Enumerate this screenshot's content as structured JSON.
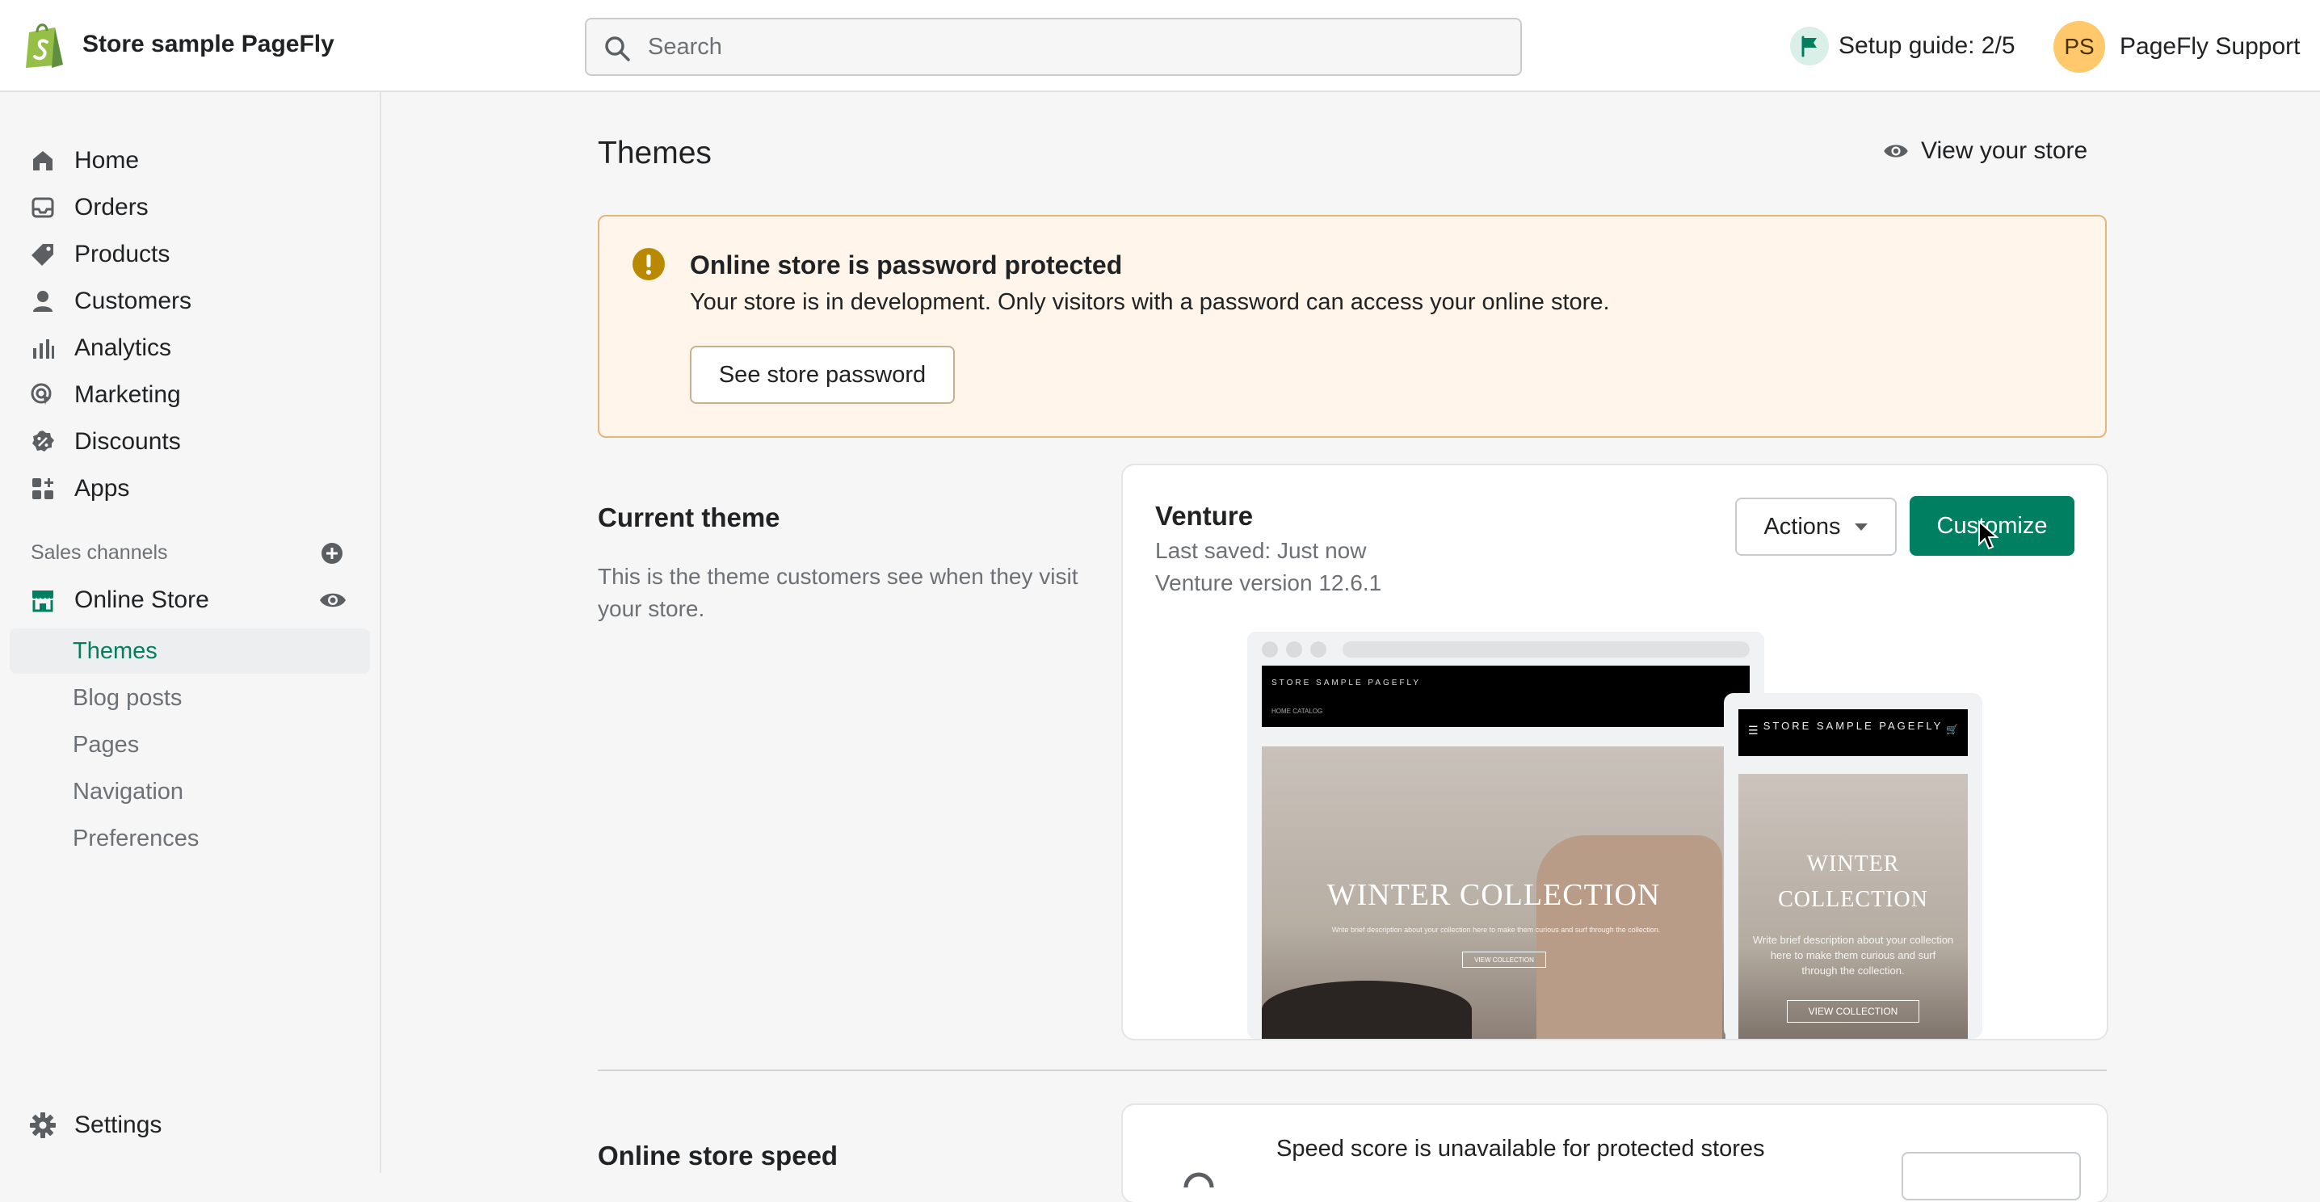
{
  "topbar": {
    "store_name": "Store sample PageFly",
    "search_placeholder": "Search",
    "setup_guide": "Setup guide: 2/5",
    "user_initials": "PS",
    "user_name": "PageFly Support"
  },
  "sidebar": {
    "items": [
      {
        "label": "Home",
        "icon": "home-icon"
      },
      {
        "label": "Orders",
        "icon": "inbox-icon"
      },
      {
        "label": "Products",
        "icon": "tag-icon"
      },
      {
        "label": "Customers",
        "icon": "person-icon"
      },
      {
        "label": "Analytics",
        "icon": "bar-chart-icon"
      },
      {
        "label": "Marketing",
        "icon": "target-icon"
      },
      {
        "label": "Discounts",
        "icon": "discount-icon"
      },
      {
        "label": "Apps",
        "icon": "apps-icon"
      }
    ],
    "sales_channels_label": "Sales channels",
    "online_store_label": "Online Store",
    "sub_items": [
      "Themes",
      "Blog posts",
      "Pages",
      "Navigation",
      "Preferences"
    ],
    "active_sub_item": "Themes",
    "settings_label": "Settings"
  },
  "main": {
    "page_title": "Themes",
    "view_store_label": "View your store",
    "banner": {
      "title": "Online store is password protected",
      "description": "Your store is in development. Only visitors with a password can access your online store.",
      "button_label": "See store password"
    },
    "current_theme": {
      "section_title": "Current theme",
      "section_description": "This is the theme customers see when they visit your store.",
      "theme_name": "Venture",
      "last_saved": "Last saved: Just now",
      "version": "Venture version 12.6.1",
      "actions_label": "Actions",
      "customize_label": "Customize"
    },
    "preview": {
      "desktop_brand": "STORE SAMPLE PAGEFLY",
      "desktop_links": "HOME     CATALOG",
      "hero_title": "WINTER COLLECTION",
      "hero_subtitle": "Write brief description about your collection here to make them curious and surf through the collection.",
      "hero_button": "VIEW COLLECTION",
      "mobile_brand": "STORE SAMPLE PAGEFLY",
      "mobile_hero_title": "WINTER COLLECTION",
      "mobile_hero_subtitle": "Write brief description about your collection here to make them curious and surf through the collection."
    },
    "speed": {
      "section_title": "Online store speed",
      "message": "Speed score is unavailable for protected stores"
    }
  },
  "colors": {
    "brand_green": "#008060",
    "banner_bg": "#fff5ea",
    "banner_border": "#e1b878",
    "warning_icon": "#b98900",
    "avatar_bg": "#ffc96b"
  }
}
